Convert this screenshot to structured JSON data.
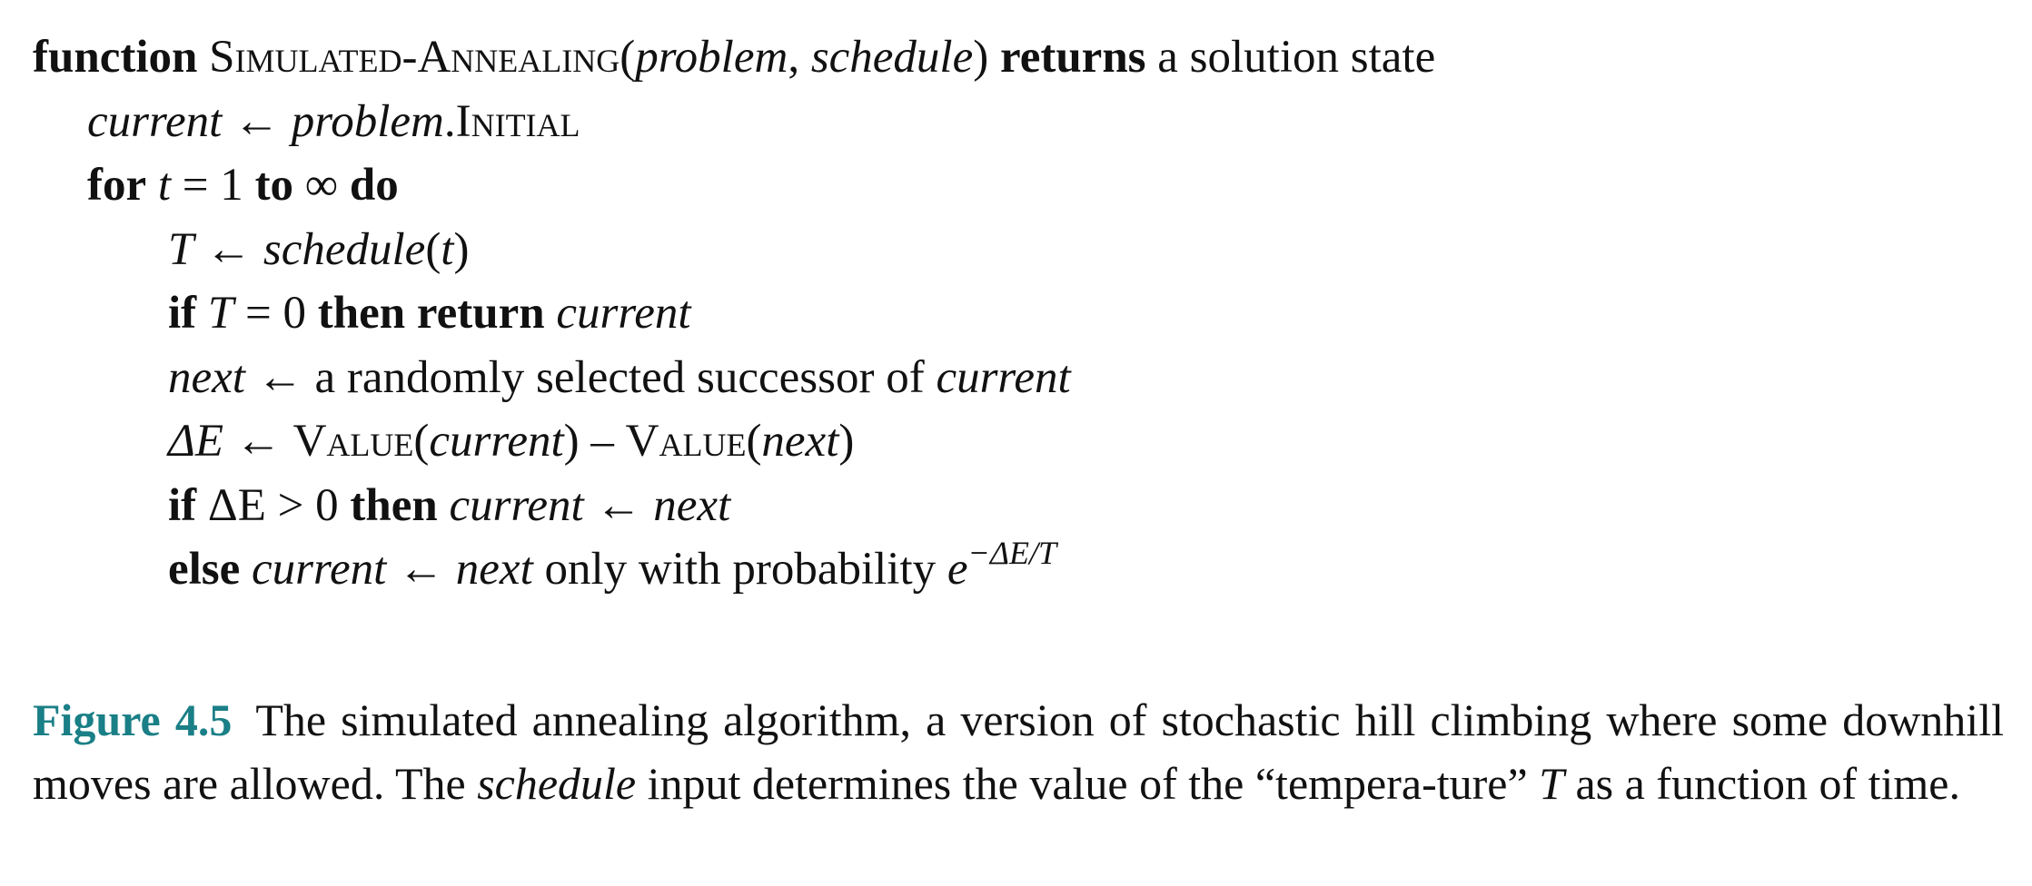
{
  "algorithm": {
    "header": {
      "kw_function": "function",
      "name": "Simulated-Annealing(",
      "param1": "problem",
      "comma": ", ",
      "param2": "schedule",
      "close": ")",
      "kw_returns": "returns",
      "rest": "a solution state"
    },
    "l1": {
      "var": "current",
      "arrow": " ← ",
      "obj": "problem",
      "dot": ".",
      "field": "Initial"
    },
    "l2": {
      "kw_for": "for",
      "var": "t",
      "eq": " = 1 ",
      "kw_to": "to",
      "inf": " ∞ ",
      "kw_do": "do"
    },
    "l3": {
      "var": "T",
      "arrow": " ← ",
      "fn": "schedule",
      "open": "(",
      "arg": "t",
      "close": ")"
    },
    "l4": {
      "kw_if": "if",
      "cond_var": "T",
      "cond_rest": " = 0 ",
      "kw_then": "then",
      "kw_return": "return",
      "ret": "current"
    },
    "l5": {
      "var": "next",
      "arrow": " ← ",
      "text": "a randomly selected successor of ",
      "obj": "current"
    },
    "l6": {
      "lhs": "ΔE",
      "arrow": " ← ",
      "fn1": "Value",
      "a1": "current",
      "minus": ") – ",
      "fn2": "Value",
      "a2": "next"
    },
    "l7": {
      "kw_if": "if",
      "cond": " ΔE > 0 ",
      "kw_then": "then",
      "var": "current",
      "arrow": " ← ",
      "val": "next"
    },
    "l8": {
      "kw_else": "else",
      "var": "current",
      "arrow": " ← ",
      "val": "next",
      "text": " only with probability ",
      "base": "e",
      "exp": "−ΔE/T"
    }
  },
  "caption": {
    "label": "Figure 4.5",
    "text1": "The simulated annealing algorithm, a version of stochastic hill climbing where some downhill moves are allowed. The ",
    "em1": "schedule",
    "text2": " input determines the value of the “tempera-ture” ",
    "em2": "T",
    "text3": " as a function of time."
  }
}
